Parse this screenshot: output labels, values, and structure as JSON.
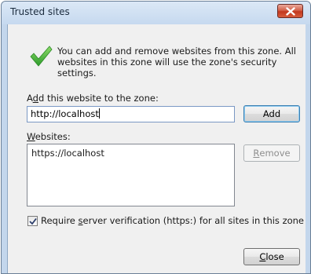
{
  "dialog": {
    "title": "Trusted sites",
    "close_icon": "close-x-icon",
    "status_icon": "green-checkmark-icon",
    "intro_text": "You can add and remove websites from this zone. All websites in this zone will use the zone's security settings."
  },
  "add_section": {
    "label_prefix": "A",
    "label_accel": "d",
    "label_suffix": "d this website to the zone:",
    "input_value": "http://localhost",
    "add_button": "Add"
  },
  "websites_section": {
    "label_accel": "W",
    "label_suffix": "ebsites:",
    "items": [
      "https://localhost"
    ],
    "remove_button_accel": "R",
    "remove_button_suffix": "emove"
  },
  "verification": {
    "checked": true,
    "label_prefix": "Require ",
    "label_accel": "s",
    "label_suffix": "erver verification (https:) for all sites in this zone"
  },
  "footer": {
    "close_accel": "C",
    "close_suffix": "lose"
  },
  "colors": {
    "close_button": "#c2391f",
    "check_green": "#3aa832",
    "default_button_border": "#3c7fb1"
  }
}
